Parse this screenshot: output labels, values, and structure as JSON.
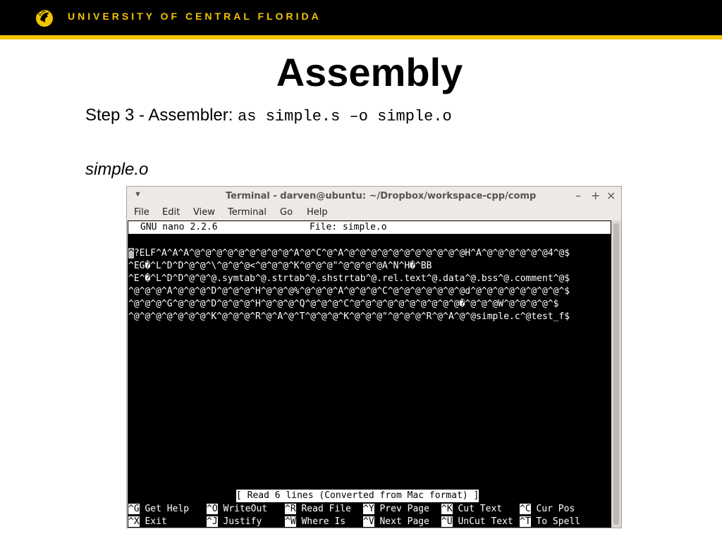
{
  "header": {
    "university": "UNIVERSITY OF CENTRAL FLORIDA",
    "accent_color": "#f2c500",
    "logo_icon": "pegasus-logo-icon"
  },
  "slide": {
    "title": "Assembly",
    "step_label": "Step 3 - Assembler:",
    "step_command": "as simple.s –o simple.o",
    "file_caption": "simple.o"
  },
  "terminal": {
    "window_title": "Terminal - darven@ubuntu: ~/Dropbox/workspace-cpp/comp",
    "controls": {
      "minimize": "–",
      "maximize": "+",
      "close": "×"
    },
    "menu": [
      "File",
      "Edit",
      "View",
      "Terminal",
      "Go",
      "Help"
    ],
    "nano": {
      "version": "GNU nano 2.2.6",
      "file_label": "File: simple.o",
      "cursor_char": "^",
      "lines": [
        "?ELF^A^A^A^@^@^@^@^@^@^@^@^@^A^@^C^@^A^@^@^@^@^@^@^@^@^@^@^@H^A^@^@^@^@^@^@4^@$",
        "^EG�^L^D^D^@^@^\\^@^@^@<^@^@^@^K^@^@^@\"^@^@^@^@A^N^H�^BB",
        "^E^�^L^D^D^@^@^@.symtab^@.strtab^@.shstrtab^@.rel.text^@.data^@.bss^@.comment^@$",
        "^@^@^@^A^@^@^@^D^@^@^@^H^@^@^@%^@^@^@^A^@^@^@^C^@^@^@^@^@^@^@d^@^@^@^@^@^@^@^@^$",
        "^@^@^@^G^@^@^@^D^@^@^@^H^@^@^@^Q^@^@^@^C^@^@^@^@^@^@^@^@^@^@�^@^@^@W^@^@^@^@^$",
        "^@^@^@^@^@^@^@^K^@^@^@^R^@^A^@^T^@^@^@^K^@^@^@\"^@^@^@^R^@^A^@^@simple.c^@test_f$"
      ],
      "status_message": "[ Read 6 lines (Converted from Mac format) ]",
      "shortcuts_row1": [
        {
          "key": "^G",
          "label": "Get Help"
        },
        {
          "key": "^O",
          "label": "WriteOut"
        },
        {
          "key": "^R",
          "label": "Read File"
        },
        {
          "key": "^Y",
          "label": "Prev Page"
        },
        {
          "key": "^K",
          "label": "Cut Text"
        },
        {
          "key": "^C",
          "label": "Cur Pos"
        }
      ],
      "shortcuts_row2": [
        {
          "key": "^X",
          "label": "Exit"
        },
        {
          "key": "^J",
          "label": "Justify"
        },
        {
          "key": "^W",
          "label": "Where Is"
        },
        {
          "key": "^V",
          "label": "Next Page"
        },
        {
          "key": "^U",
          "label": "UnCut Text"
        },
        {
          "key": "^T",
          "label": "To Spell"
        }
      ]
    }
  }
}
